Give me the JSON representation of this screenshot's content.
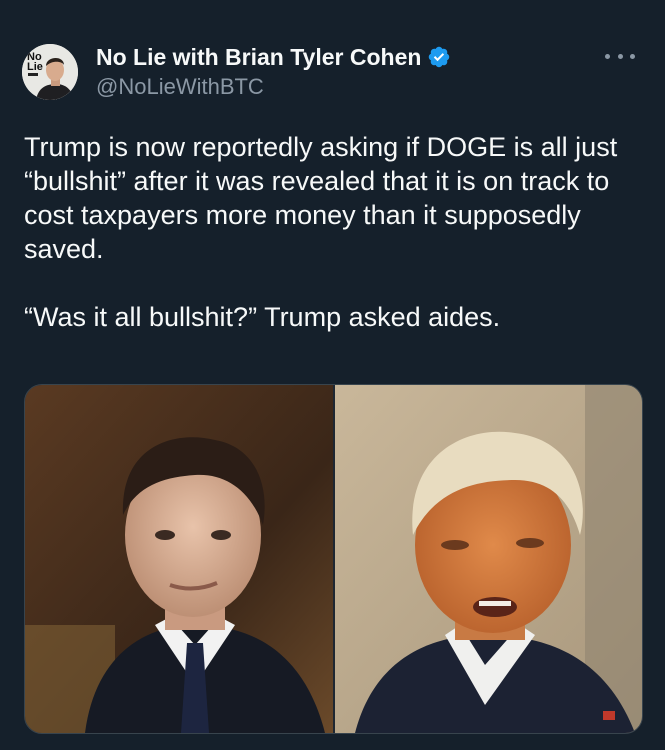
{
  "tweet": {
    "author": {
      "display_name": "No Lie with Brian Tyler Cohen",
      "handle": "@NoLieWithBTC",
      "verified": true,
      "avatar_badge_line1": "No",
      "avatar_badge_line2": "Lie"
    },
    "paragraphs": [
      "Trump is now reportedly asking if DOGE is all just “bullshit” after it was revealed that it is on track to cost taxpayers more money than it supposedly saved.",
      "“Was it all bullshit?” Trump asked aides."
    ],
    "media": {
      "count": 2
    },
    "icons": {
      "more": "more-options-icon",
      "verified": "verified-badge-icon"
    }
  },
  "colors": {
    "background": "#15202b",
    "text": "#f7f9f9",
    "secondary_text": "#8b98a5",
    "verified_blue": "#1d9bf0",
    "border": "#38444d"
  }
}
